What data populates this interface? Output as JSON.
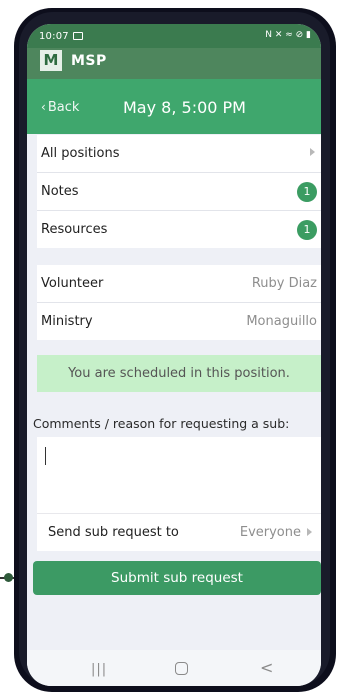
{
  "status_bar": {
    "time": "10:07",
    "right_icons": "N ✕ ≈ ⊘ ▮"
  },
  "app": {
    "logo_letter": "M",
    "name": "MSP"
  },
  "nav": {
    "back_label": "Back",
    "title": "May 8, 5:00 PM"
  },
  "list": [
    {
      "label": "All positions",
      "badge": null
    },
    {
      "label": "Notes",
      "badge": "1"
    },
    {
      "label": "Resources",
      "badge": "1"
    }
  ],
  "details": [
    {
      "label": "Volunteer",
      "value": "Ruby Diaz"
    },
    {
      "label": "Ministry",
      "value": "Monaguillo"
    }
  ],
  "banner": "You are scheduled in this position.",
  "comments_label": "Comments / reason for requesting a sub:",
  "comment_value": "",
  "send_to": {
    "label": "Send sub request to",
    "value": "Everyone"
  },
  "submit_label": "Submit sub request",
  "android_nav": {
    "recent": "|||",
    "back": "<"
  }
}
